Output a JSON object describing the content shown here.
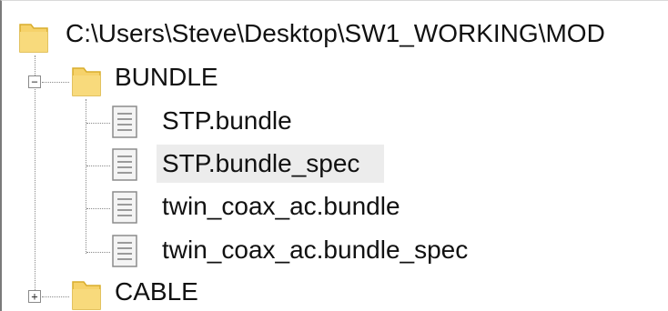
{
  "tree": {
    "root": {
      "label": "C:\\Users\\Steve\\Desktop\\SW1_WORKING\\MOD",
      "icon": "folder-icon"
    },
    "folders": [
      {
        "label": "BUNDLE",
        "expanded": true,
        "expander_glyph": "−",
        "icon": "folder-open-icon",
        "children": [
          {
            "label": "STP.bundle",
            "icon": "file-icon",
            "selected": false
          },
          {
            "label": "STP.bundle_spec",
            "icon": "file-icon",
            "selected": true
          },
          {
            "label": "twin_coax_ac.bundle",
            "icon": "file-icon",
            "selected": false
          },
          {
            "label": "twin_coax_ac.bundle_spec",
            "icon": "file-icon",
            "selected": false
          }
        ]
      },
      {
        "label": "CABLE",
        "expanded": false,
        "expander_glyph": "+",
        "icon": "folder-icon"
      }
    ]
  },
  "colors": {
    "folder": "#f6d26a",
    "folder_edge": "#d9ad2c",
    "selection": "#ececec",
    "text": "#111111"
  }
}
